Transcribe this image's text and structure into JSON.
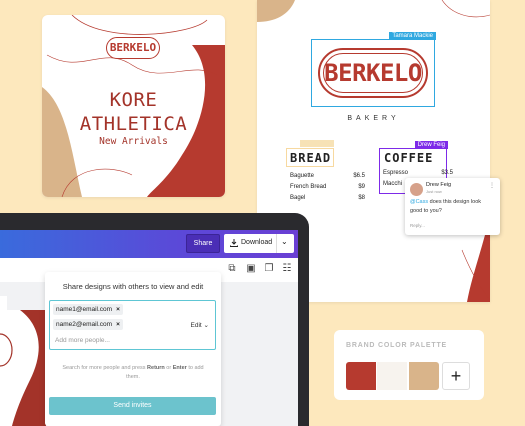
{
  "kore_card": {
    "stamp": "BERKELO",
    "line1": "KORE",
    "line2": "ATHLETICA",
    "line3": "New Arrivals"
  },
  "menu_card": {
    "logo_text": "BERKELO",
    "logo_editor": "Tamara Mackie",
    "bakery": "BAKERY",
    "bread_title": "BREAD",
    "bread_items": [
      {
        "name": "Baguette",
        "price": "$6.5"
      },
      {
        "name": "French Bread",
        "price": "$9"
      },
      {
        "name": "Bagel",
        "price": "$8"
      }
    ],
    "coffee_editor": "Drew Feig",
    "coffee_title": "COFFEE",
    "coffee_items": [
      {
        "name": "Espresso",
        "price": "$3.5"
      },
      {
        "name": "Macchi",
        "price": ""
      }
    ]
  },
  "comment": {
    "author": "Drew Feig",
    "time": "Just now",
    "mention": "@Cass",
    "text": " does this design look good to you?",
    "reply_placeholder": "Reply..."
  },
  "palette": {
    "title": "BRAND COLOR PALETTE",
    "colors": [
      "#b63a2f",
      "#f7f3ee",
      "#d9b48a"
    ],
    "add_label": "+"
  },
  "editor": {
    "share_label": "Share",
    "download_label": "Download",
    "panel_header": "Share designs with others to view and edit",
    "emails": [
      "name1@email.com",
      "name2@email.com"
    ],
    "permission": "Edit",
    "add_placeholder": "Add more people...",
    "hint_pre": "Search for more people and press ",
    "hint_key1": "Return",
    "hint_mid": " or ",
    "hint_key2": "Enter",
    "hint_post": " to add them.",
    "send_label": "Send invites"
  }
}
